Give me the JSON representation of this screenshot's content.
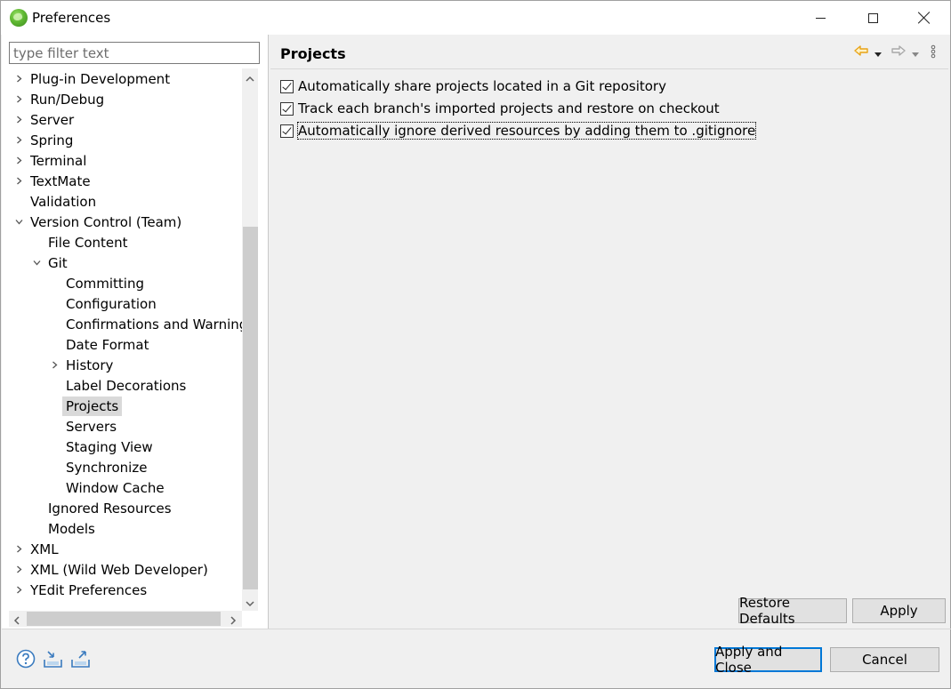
{
  "window": {
    "title": "Preferences"
  },
  "filter": {
    "placeholder": "type filter text"
  },
  "tree": {
    "items": [
      {
        "label": "Plug-in Development",
        "expander": "collapsed",
        "level": 0
      },
      {
        "label": "Run/Debug",
        "expander": "collapsed",
        "level": 0
      },
      {
        "label": "Server",
        "expander": "collapsed",
        "level": 0
      },
      {
        "label": "Spring",
        "expander": "collapsed",
        "level": 0
      },
      {
        "label": "Terminal",
        "expander": "collapsed",
        "level": 0
      },
      {
        "label": "TextMate",
        "expander": "collapsed",
        "level": 0
      },
      {
        "label": "Validation",
        "expander": "none",
        "level": 0
      },
      {
        "label": "Version Control (Team)",
        "expander": "expanded",
        "level": 0
      },
      {
        "label": "File Content",
        "expander": "none",
        "level": 1
      },
      {
        "label": "Git",
        "expander": "expanded",
        "level": 1
      },
      {
        "label": "Committing",
        "expander": "none",
        "level": 2
      },
      {
        "label": "Configuration",
        "expander": "none",
        "level": 2
      },
      {
        "label": "Confirmations and Warnings",
        "expander": "none",
        "level": 2
      },
      {
        "label": "Date Format",
        "expander": "none",
        "level": 2
      },
      {
        "label": "History",
        "expander": "collapsed",
        "level": 2
      },
      {
        "label": "Label Decorations",
        "expander": "none",
        "level": 2
      },
      {
        "label": "Projects",
        "expander": "none",
        "level": 2,
        "selected": true
      },
      {
        "label": "Servers",
        "expander": "none",
        "level": 2
      },
      {
        "label": "Staging View",
        "expander": "none",
        "level": 2
      },
      {
        "label": "Synchronize",
        "expander": "none",
        "level": 2
      },
      {
        "label": "Window Cache",
        "expander": "none",
        "level": 2
      },
      {
        "label": "Ignored Resources",
        "expander": "none",
        "level": 1
      },
      {
        "label": "Models",
        "expander": "none",
        "level": 1
      },
      {
        "label": "XML",
        "expander": "collapsed",
        "level": 0
      },
      {
        "label": "XML (Wild Web Developer)",
        "expander": "collapsed",
        "level": 0
      },
      {
        "label": "YEdit Preferences",
        "expander": "collapsed",
        "level": 0
      }
    ]
  },
  "page": {
    "title": "Projects",
    "options": [
      {
        "label": "Automatically share projects located in a Git repository",
        "checked": true
      },
      {
        "label": "Track each branch's imported projects and restore on checkout",
        "checked": true
      },
      {
        "label": "Automatically ignore derived resources by adding them to .gitignore",
        "checked": true,
        "focused": true
      }
    ],
    "restore_defaults_label": "Restore Defaults",
    "apply_label": "Apply"
  },
  "footer": {
    "apply_close_label": "Apply and Close",
    "cancel_label": "Cancel"
  },
  "icons": {
    "back": "back-arrow-icon",
    "forward": "forward-arrow-icon",
    "menu": "view-menu-icon",
    "help": "help-icon",
    "import": "import-icon",
    "export": "export-icon"
  },
  "colors": {
    "back_arrow": "#e8a317",
    "selection": "#d9d9d9",
    "default_button_border": "#0078d7",
    "help_blue": "#3a7bbf"
  }
}
